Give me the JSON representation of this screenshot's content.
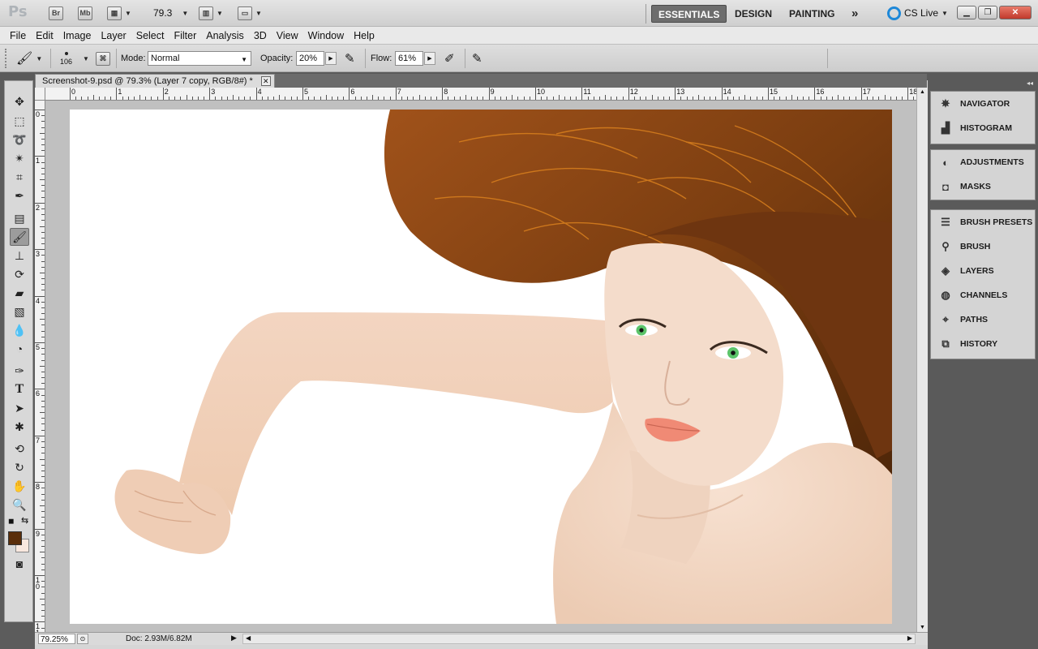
{
  "app_bar": {
    "logo": "Ps",
    "bridge_btn": "Br",
    "minibridge_btn": "Mb",
    "zoom_value": "79.3",
    "workspaces": [
      "ESSENTIALS",
      "DESIGN",
      "PAINTING"
    ],
    "more_icon": "»",
    "cs_live": "CS Live"
  },
  "menus": [
    "File",
    "Edit",
    "Image",
    "Layer",
    "Select",
    "Filter",
    "Analysis",
    "3D",
    "View",
    "Window",
    "Help"
  ],
  "options_bar": {
    "brush_size": "106",
    "mode_label": "Mode:",
    "mode_value": "Normal",
    "opacity_label": "Opacity:",
    "opacity_value": "20%",
    "flow_label": "Flow:",
    "flow_value": "61%"
  },
  "document": {
    "tab_title": "Screenshot-9.psd @ 79.3% (Layer 7 copy, RGB/8#) *",
    "ruler_top_ticks": [
      "0",
      "1",
      "2",
      "3",
      "4",
      "5",
      "6",
      "7",
      "8",
      "9",
      "10",
      "11",
      "12",
      "13",
      "14",
      "15",
      "16",
      "17",
      "18"
    ],
    "ruler_left_ticks": [
      "0",
      "1",
      "2",
      "3",
      "4",
      "5",
      "6",
      "7",
      "8",
      "9",
      "1\n0",
      "1\n1"
    ]
  },
  "status_bar": {
    "zoom": "79.25%",
    "doc_info": "Doc: 2.93M/6.82M"
  },
  "panels": {
    "group1": [
      "NAVIGATOR",
      "HISTOGRAM"
    ],
    "group2": [
      "ADJUSTMENTS",
      "MASKS"
    ],
    "group3": [
      "BRUSH PRESETS",
      "BRUSH",
      "LAYERS",
      "CHANNELS",
      "PATHS",
      "HISTORY"
    ]
  },
  "colors": {
    "foreground": "#5a2e0a",
    "background": "#f9e8de",
    "hair": "#8b4513",
    "skin": "#f3d7c3"
  }
}
